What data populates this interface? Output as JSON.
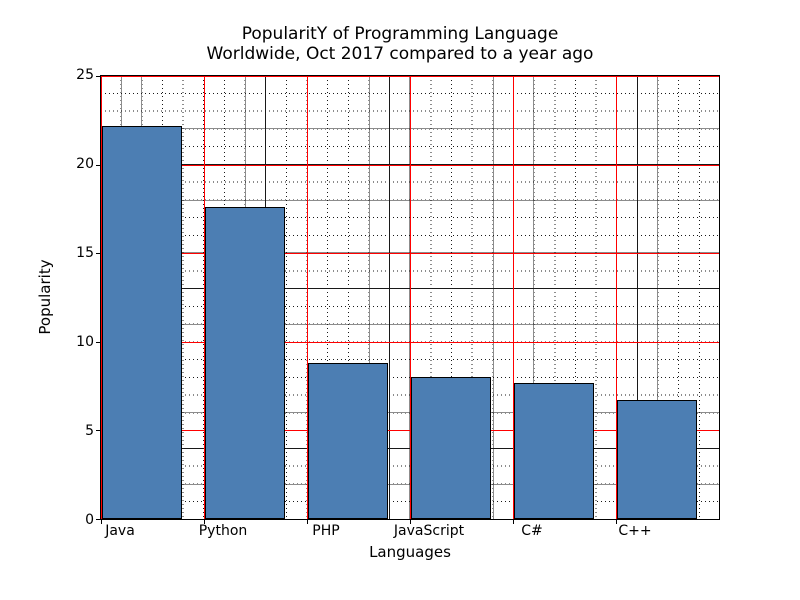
{
  "chart_data": {
    "type": "bar",
    "categories": [
      "Java",
      "Python",
      "PHP",
      "JavaScript",
      "C#",
      "C++"
    ],
    "values": [
      22.2,
      17.6,
      8.8,
      8.0,
      7.7,
      6.7
    ],
    "title_line1": "PopularitY of Programming Language",
    "title_line2": "Worldwide, Oct 2017 compared to a year ago",
    "xlabel": "Languages",
    "ylabel": "Popularity",
    "ylim": [
      0,
      25
    ],
    "yticks": [
      0,
      5,
      10,
      15,
      20,
      25
    ]
  }
}
